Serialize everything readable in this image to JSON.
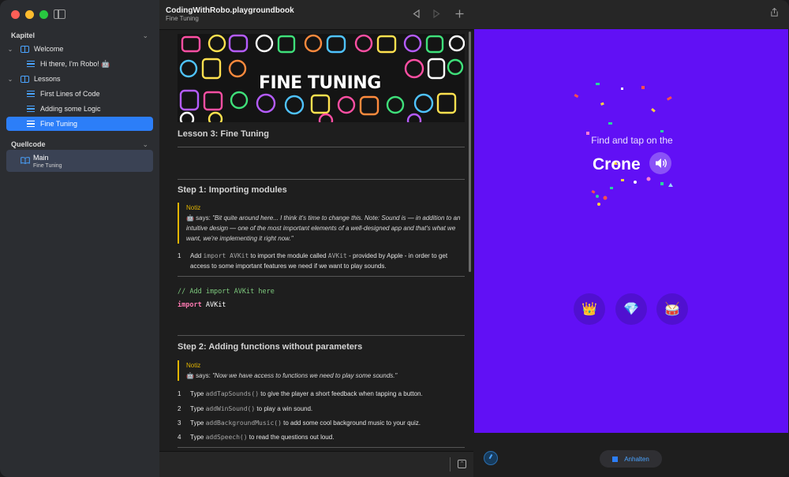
{
  "sidebar": {
    "section_chapters": "Kapitel",
    "welcome": "Welcome",
    "hi_robo": "Hi there, I'm Robo! 🤖",
    "lessons": "Lessons",
    "lesson1": "First Lines of Code",
    "lesson2": "Adding some Logic",
    "lesson3": "Fine Tuning",
    "section_source": "Quellcode",
    "main_title": "Main",
    "main_sub": "Fine Tuning"
  },
  "header": {
    "title": "CodingWithRobo.playgroundbook",
    "subtitle": "Fine Tuning"
  },
  "doc": {
    "banner_text": "FINE TUNING",
    "lesson_heading": "Lesson 3: Fine Tuning",
    "step1_heading": "Step 1: Importing modules",
    "note_label": "Notiz",
    "note1_prefix": "🤖 says: ",
    "note1_text": "\"Bit quite around here... I think it's time to change this. Note: Sound is — in addition to an intuitive design — one of the most important elements of a well-designed app and that's what we want, we're implementing it right now.\"",
    "s1_num": "1",
    "s1_a": "Add ",
    "s1_code1": "import AVKit",
    "s1_b": " to import the module called ",
    "s1_code2": "AVKit",
    "s1_c": " - provided by Apple - in order to get access to some important features we need if we want to play sounds.",
    "code_comment": "// Add import AVKit here",
    "code_kw": "import",
    "code_ident": " AVKit",
    "step2_heading": "Step 2: Adding functions without parameters",
    "note2_prefix": "🤖 says: ",
    "note2_text": "\"Now we have access to functions we need to play some sounds.\"",
    "s2_items": [
      {
        "num": "1",
        "a": "Type ",
        "code": "addTapSounds()",
        "b": " to give the player a short feedback when tapping a button."
      },
      {
        "num": "2",
        "a": "Type ",
        "code": "addWinSound()",
        "b": " to play a win sound."
      },
      {
        "num": "3",
        "a": "Type ",
        "code": "addBackgroundMusic()",
        "b": " to add some cool background music to your quiz."
      },
      {
        "num": "4",
        "a": "Type ",
        "code": "addSpeech()",
        "b": " to read the questions out loud."
      }
    ]
  },
  "stage": {
    "prompt": "Find and tap on the",
    "word": "Crone",
    "options": [
      "👑",
      "💎",
      "🥁"
    ]
  },
  "footer": {
    "stop_label": "Anhalten"
  },
  "colors": {
    "accent": "#2c7ef8",
    "stage_bg": "#6110f5",
    "note_bar": "#e2b500"
  }
}
